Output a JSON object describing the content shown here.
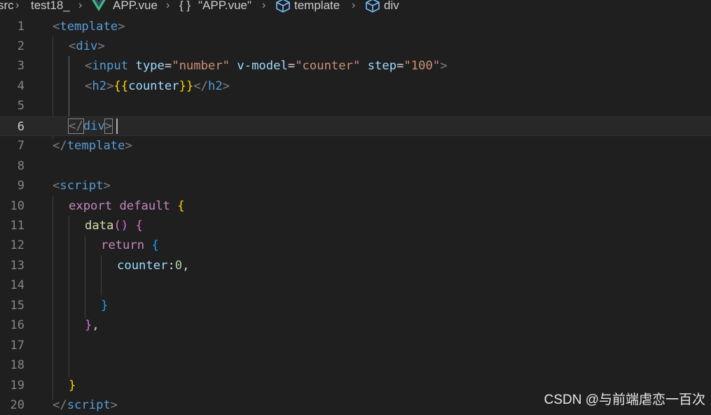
{
  "breadcrumb": {
    "items": [
      "src",
      "test18_",
      "APP.vue",
      "{ }",
      "\"APP.vue\"",
      "template",
      "div"
    ]
  },
  "editor": {
    "current_line": 6,
    "lines": [
      {
        "n": "1"
      },
      {
        "n": "2"
      },
      {
        "n": "3"
      },
      {
        "n": "4"
      },
      {
        "n": "5"
      },
      {
        "n": "6"
      },
      {
        "n": "7"
      },
      {
        "n": "8"
      },
      {
        "n": "9"
      },
      {
        "n": "10"
      },
      {
        "n": "11"
      },
      {
        "n": "12"
      },
      {
        "n": "13"
      },
      {
        "n": "14"
      },
      {
        "n": "15"
      },
      {
        "n": "16"
      },
      {
        "n": "17"
      },
      {
        "n": "18"
      },
      {
        "n": "19"
      },
      {
        "n": "20"
      }
    ],
    "tokens": {
      "lt": "<",
      "gt": ">",
      "lts": "</",
      "template": "template",
      "div": "div",
      "input": "input",
      "h2": "h2",
      "script": "script",
      "type": "type",
      "eq": "=",
      "number": "\"number\"",
      "vmodel": "v-model",
      "counter_str": "\"counter\"",
      "step": "step",
      "hundred": "\"100\"",
      "mustache_open": "{{",
      "counter": "counter",
      "mustache_close": "}}",
      "export": "export",
      "default": "default",
      "lbrace": "{",
      "rbrace": "}",
      "data": "data",
      "parens": "()",
      "return": "return",
      "colon": ":",
      "zero": "0",
      "comma": ",",
      "closing_brace_comma": "},"
    }
  },
  "watermark": "CSDN @与前端虐恋一百次",
  "colors": {
    "background": "#1f1f1f",
    "tag": "#569cd6",
    "attribute": "#9cdcfe",
    "string": "#ce9178",
    "keyword": "#c586c0",
    "function": "#dcdcaa",
    "number": "#b5cea8",
    "bracket1": "#ffd700",
    "bracket2": "#da70d6",
    "bracket3": "#179fff"
  },
  "icons": [
    "vue-icon",
    "symbol-module-icon",
    "chevron-right-icon"
  ]
}
